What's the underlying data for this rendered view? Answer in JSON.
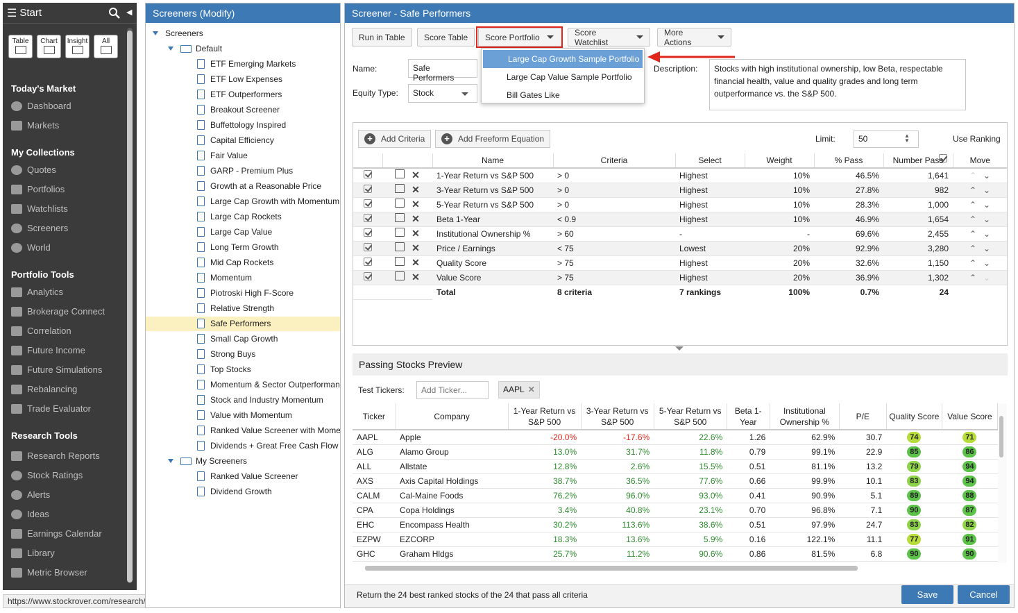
{
  "sidebar": {
    "title": "Start",
    "quick_buttons": [
      "Table",
      "Chart",
      "Insight",
      "All"
    ],
    "sections": [
      {
        "title": "Today's Market",
        "items": [
          "Dashboard",
          "Markets"
        ]
      },
      {
        "title": "My Collections",
        "items": [
          "Quotes",
          "Portfolios",
          "Watchlists",
          "Screeners",
          "World"
        ]
      },
      {
        "title": "Portfolio Tools",
        "items": [
          "Analytics",
          "Brokerage Connect",
          "Correlation",
          "Future Income",
          "Future Simulations",
          "Rebalancing",
          "Trade Evaluator"
        ]
      },
      {
        "title": "Research Tools",
        "items": [
          "Research Reports",
          "Stock Ratings",
          "Alerts",
          "Ideas",
          "Earnings Calendar",
          "Library",
          "Metric Browser"
        ]
      }
    ],
    "status_url": "https://www.stockrover.com/research/#"
  },
  "tree": {
    "title": "Screeners (Modify)",
    "root": "Screeners",
    "default_folder": "Default",
    "default_items": [
      "ETF Emerging Markets",
      "ETF Low Expenses",
      "ETF Outperformers",
      "Breakout Screener",
      "Buffettology Inspired",
      "Capital Efficiency",
      "Fair Value",
      "GARP - Premium Plus",
      "Growth at a Reasonable Price",
      "Large Cap Growth with Momentum",
      "Large Cap Rockets",
      "Large Cap Value",
      "Long Term Growth",
      "Mid Cap Rockets",
      "Momentum",
      "Piotroski High F-Score",
      "Relative Strength",
      "Safe Performers",
      "Small Cap Growth",
      "Strong Buys",
      "Top Stocks",
      "Momentum & Sector Outperformance",
      "Stock and Industry Momentum",
      "Value with Momentum",
      "Ranked Value Screener with Momentum",
      "Dividends + Great Free Cash Flow"
    ],
    "selected": "Safe Performers",
    "my_folder": "My Screeners",
    "my_items": [
      "Ranked Value Screener",
      "Dividend Growth"
    ]
  },
  "main": {
    "title": "Screener - Safe Performers",
    "toolbar": [
      "Run in Table",
      "Score Table",
      "Score Portfolio",
      "Score Watchlist",
      "More Actions"
    ],
    "dropdown": [
      "Large Cap Growth Sample Portfolio",
      "Large Cap Value Sample Portfolio",
      "Bill Gates Like"
    ],
    "name_label": "Name:",
    "name_value": "Safe Performers",
    "equity_label": "Equity Type:",
    "equity_value": "Stock",
    "desc_label": "Description:",
    "desc_value": "Stocks with high institutional ownership, low Beta, respectable financial health, value and quality grades and long term outperformance vs. the S&P 500.",
    "add_criteria": "Add Criteria",
    "add_freeform": "Add Freeform Equation",
    "limit_label": "Limit:",
    "limit_value": "50",
    "use_ranking": "Use Ranking",
    "criteria_headers": [
      "Name",
      "Criteria",
      "Select",
      "Weight",
      "% Pass",
      "Number Pass",
      "Move"
    ],
    "criteria": [
      [
        "1-Year Return vs S&P 500",
        "> 0",
        "Highest",
        "10%",
        "46.5%",
        "1,641"
      ],
      [
        "3-Year Return vs S&P 500",
        "> 0",
        "Highest",
        "10%",
        "27.8%",
        "982"
      ],
      [
        "5-Year Return vs S&P 500",
        "> 0",
        "Highest",
        "10%",
        "28.3%",
        "1,000"
      ],
      [
        "Beta 1-Year",
        "< 0.9",
        "Highest",
        "10%",
        "46.9%",
        "1,654"
      ],
      [
        "Institutional Ownership %",
        "> 60",
        "-",
        "-",
        "69.6%",
        "2,455"
      ],
      [
        "Price / Earnings",
        "< 75",
        "Lowest",
        "20%",
        "92.9%",
        "3,280"
      ],
      [
        "Quality Score",
        "> 75",
        "Highest",
        "20%",
        "32.6%",
        "1,150"
      ],
      [
        "Value Score",
        "> 75",
        "Highest",
        "20%",
        "36.9%",
        "1,302"
      ]
    ],
    "total": [
      "Total",
      "8 criteria",
      "7 rankings",
      "100%",
      "0.7%",
      "24"
    ],
    "preview_title": "Passing Stocks Preview",
    "test_label": "Test Tickers:",
    "ticker_placeholder": "Add Ticker...",
    "ticker_tag": "AAPL",
    "preview_headers": [
      "Ticker",
      "Company",
      "1-Year Return vs S&P 500",
      "3-Year Return vs S&P 500",
      "5-Year Return vs S&P 500",
      "Beta 1-Year",
      "Institutional Ownership %",
      "P/E",
      "Quality Score",
      "Value Score"
    ],
    "preview_rows": [
      [
        "AAPL",
        "Apple",
        "-20.0%",
        "-17.6%",
        "22.6%",
        "1.26",
        "62.9%",
        "30.7",
        "74",
        "71"
      ],
      [
        "ALG",
        "Alamo Group",
        "13.0%",
        "31.7%",
        "11.8%",
        "0.79",
        "99.1%",
        "22.9",
        "85",
        "86"
      ],
      [
        "ALL",
        "Allstate",
        "12.8%",
        "2.6%",
        "15.5%",
        "0.51",
        "81.1%",
        "13.2",
        "79",
        "94"
      ],
      [
        "AXS",
        "Axis Capital Holdings",
        "38.7%",
        "36.5%",
        "77.6%",
        "0.66",
        "99.9%",
        "10.1",
        "83",
        "94"
      ],
      [
        "CALM",
        "Cal-Maine Foods",
        "76.2%",
        "96.0%",
        "93.0%",
        "0.41",
        "90.9%",
        "5.1",
        "89",
        "88"
      ],
      [
        "CPA",
        "Copa Holdings",
        "3.4%",
        "40.8%",
        "23.1%",
        "0.70",
        "96.8%",
        "7.1",
        "90",
        "87"
      ],
      [
        "EHC",
        "Encompass Health",
        "30.2%",
        "113.6%",
        "38.6%",
        "0.51",
        "97.9%",
        "24.7",
        "83",
        "82"
      ],
      [
        "EZPW",
        "EZCORP",
        "18.3%",
        "13.6%",
        "5.9%",
        "0.16",
        "122.1%",
        "11.1",
        "77",
        "91"
      ],
      [
        "GHC",
        "Graham Hldgs",
        "25.7%",
        "11.2%",
        "90.6%",
        "0.86",
        "81.5%",
        "6.8",
        "90",
        "90"
      ]
    ],
    "footer_text": "Return the 24 best ranked stocks of the 24 that pass all criteria",
    "save": "Save",
    "cancel": "Cancel"
  }
}
